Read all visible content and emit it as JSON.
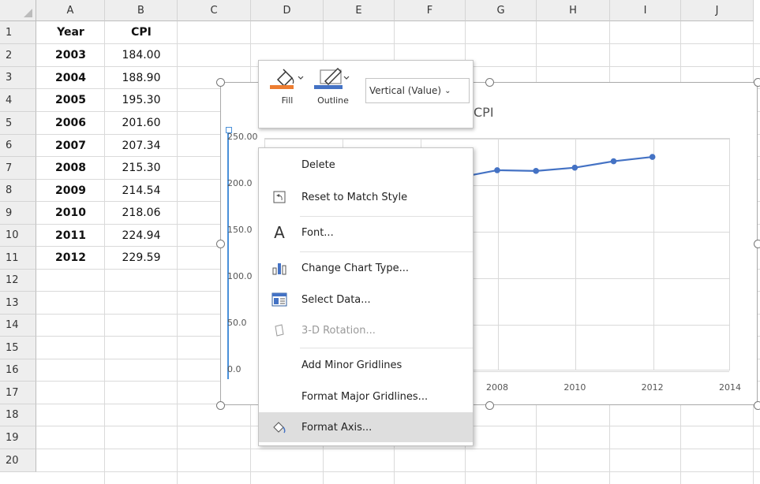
{
  "columns": [
    "A",
    "B",
    "C",
    "D",
    "E",
    "F",
    "G",
    "H",
    "I",
    "J"
  ],
  "rows": [
    "1",
    "2",
    "3",
    "4",
    "5",
    "6",
    "7",
    "8",
    "9",
    "10",
    "11",
    "12",
    "13",
    "14",
    "15",
    "16",
    "17",
    "18",
    "19",
    "20"
  ],
  "table": {
    "headers": [
      "Year",
      "CPI"
    ],
    "records": [
      [
        "2003",
        "184.00"
      ],
      [
        "2004",
        "188.90"
      ],
      [
        "2005",
        "195.30"
      ],
      [
        "2006",
        "201.60"
      ],
      [
        "2007",
        "207.34"
      ],
      [
        "2008",
        "215.30"
      ],
      [
        "2009",
        "214.54"
      ],
      [
        "2010",
        "218.06"
      ],
      [
        "2011",
        "224.94"
      ],
      [
        "2012",
        "229.59"
      ]
    ]
  },
  "chart": {
    "title": "CPI",
    "y_ticks_visible": [
      "250.00",
      "200.0",
      "150.0",
      "100.0",
      "50.0",
      "0.0"
    ],
    "x_ticks_visible": [
      "2008",
      "2010",
      "2012",
      "2014"
    ],
    "series_color": "#4472c4"
  },
  "chart_data": {
    "type": "scatter",
    "title": "CPI",
    "x": [
      2003,
      2004,
      2005,
      2006,
      2007,
      2008,
      2009,
      2010,
      2011,
      2012
    ],
    "y": [
      184.0,
      188.9,
      195.3,
      201.6,
      207.34,
      215.3,
      214.54,
      218.06,
      224.94,
      229.59
    ],
    "ylim": [
      0,
      250
    ],
    "xlim": [
      2002,
      2014
    ],
    "grid": true,
    "lines_connected": true
  },
  "minitoolbar": {
    "fill_label": "Fill",
    "outline_label": "Outline",
    "element_select": "Vertical (Value)",
    "fill_color": "#ed7d31",
    "outline_color": "#4472c4"
  },
  "contextmenu": {
    "items": [
      {
        "label": "Delete",
        "icon": "none",
        "enabled": true
      },
      {
        "label": "Reset to Match Style",
        "icon": "reset-style-icon",
        "enabled": true
      },
      {
        "label": "Font...",
        "icon": "font-icon",
        "enabled": true
      },
      {
        "label": "Change Chart Type...",
        "icon": "chart-type-icon",
        "enabled": true
      },
      {
        "label": "Select Data...",
        "icon": "select-data-icon",
        "enabled": true
      },
      {
        "label": "3-D Rotation...",
        "icon": "rotation-icon",
        "enabled": false
      },
      {
        "label": "Add Minor Gridlines",
        "icon": "none",
        "enabled": true
      },
      {
        "label": "Format Major Gridlines...",
        "icon": "none",
        "enabled": true
      },
      {
        "label": "Format Axis...",
        "icon": "format-axis-icon",
        "enabled": true,
        "highlighted": true
      }
    ]
  }
}
